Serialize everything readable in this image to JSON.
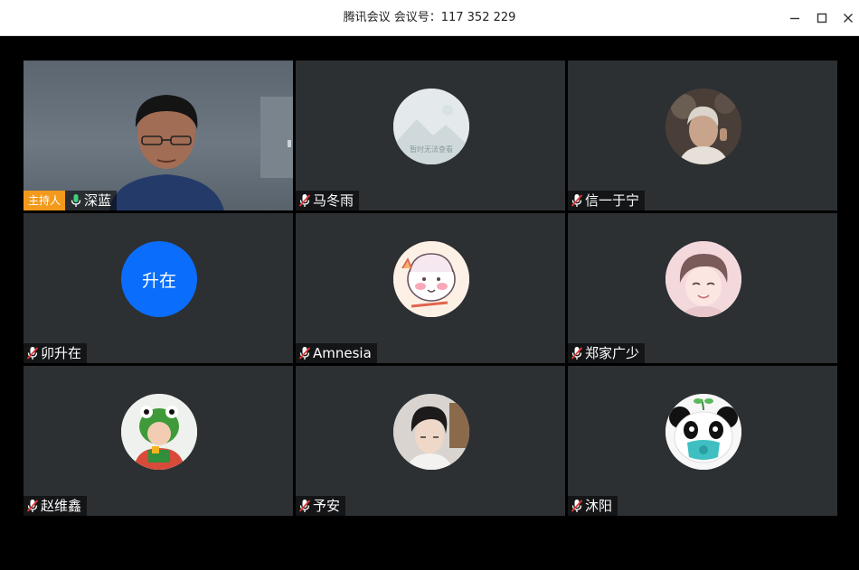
{
  "window": {
    "title": "腾讯会议 会议号：117 352 229",
    "minimize_icon": "minimize-icon",
    "maximize_icon": "maximize-icon",
    "close_icon": "close-icon"
  },
  "participants": [
    {
      "name": "深蓝",
      "host_label": "主持人",
      "mic": "on",
      "avatar": "video"
    },
    {
      "name": "马冬雨",
      "mic": "muted",
      "avatar": "placeholder-image"
    },
    {
      "name": "信一于宁",
      "mic": "muted",
      "avatar": "photo-man"
    },
    {
      "name": "卯升在",
      "mic": "muted",
      "avatar_text": "升在",
      "avatar_color": "#0a6dfc"
    },
    {
      "name": "Amnesia",
      "mic": "muted",
      "avatar": "cartoon-girl"
    },
    {
      "name": "郑家广少",
      "mic": "muted",
      "avatar": "anime-boy"
    },
    {
      "name": "赵维鑫",
      "mic": "muted",
      "avatar": "photo-child-frog-hat"
    },
    {
      "name": "予安",
      "mic": "muted",
      "avatar": "photo-young-man"
    },
    {
      "name": "沐阳",
      "mic": "muted",
      "avatar": "panda-with-mask"
    }
  ],
  "placeholder_caption": "暂时无法查看",
  "colors": {
    "tile_bg": "#2d3033",
    "host_badge": "#f39a1d",
    "mic_on": "#3dd17a",
    "mic_muted": "#e03a3a",
    "avatar_blue": "#0a6dfc"
  }
}
